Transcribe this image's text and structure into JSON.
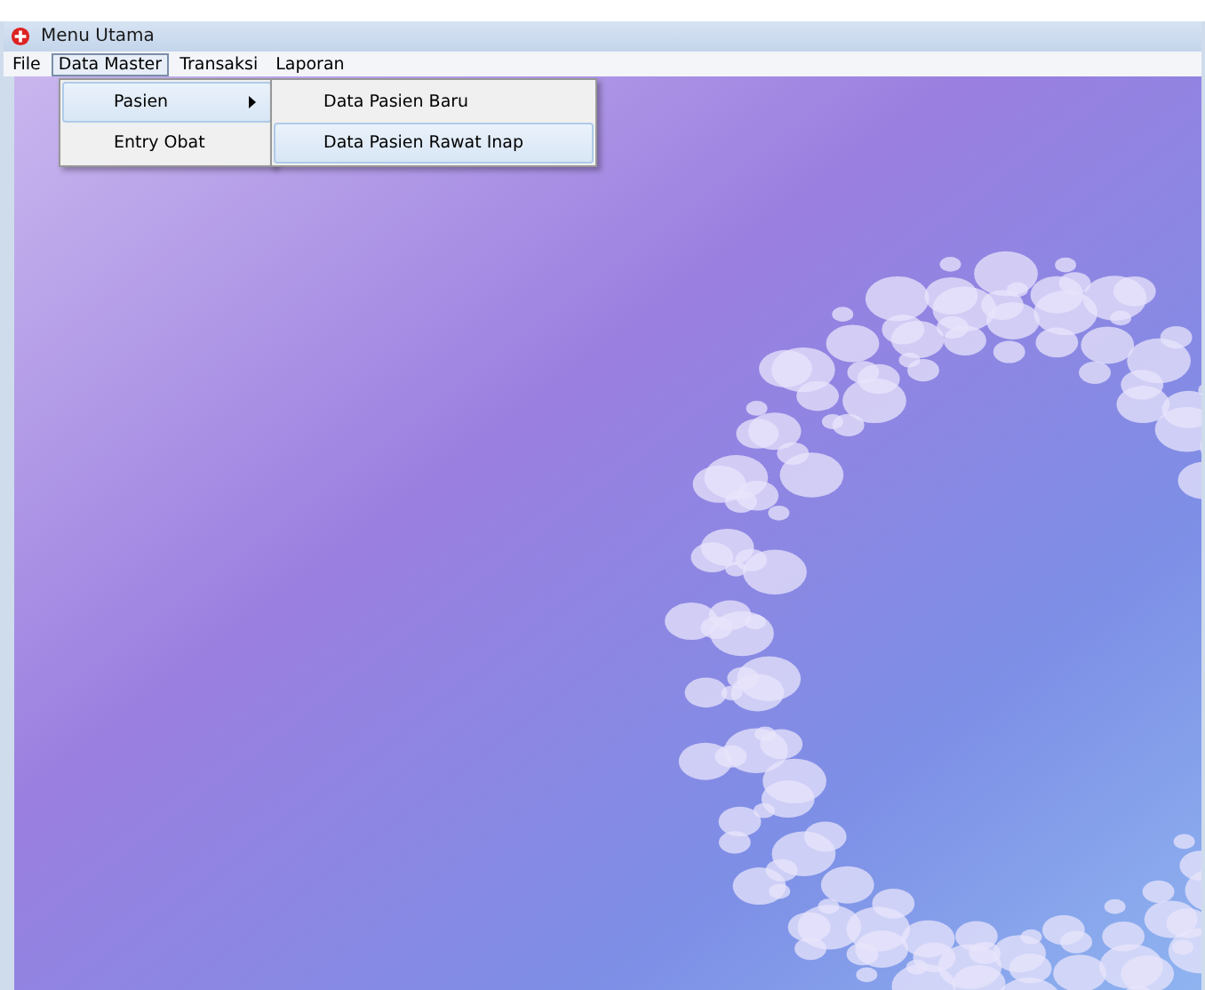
{
  "window": {
    "title": "Menu Utama"
  },
  "menubar": [
    {
      "label": "File",
      "selected": false
    },
    {
      "label": "Data Master",
      "selected": true
    },
    {
      "label": "Transaksi",
      "selected": false
    },
    {
      "label": "Laporan",
      "selected": false
    }
  ],
  "dropdown": [
    {
      "label": "Pasien",
      "selected": true,
      "has_submenu": true
    },
    {
      "label": "Entry Obat",
      "selected": false,
      "has_submenu": false
    }
  ],
  "submenu": [
    {
      "label": "Data Pasien Baru",
      "selected": false
    },
    {
      "label": "Data Pasien Rawat Inap",
      "selected": true
    }
  ]
}
